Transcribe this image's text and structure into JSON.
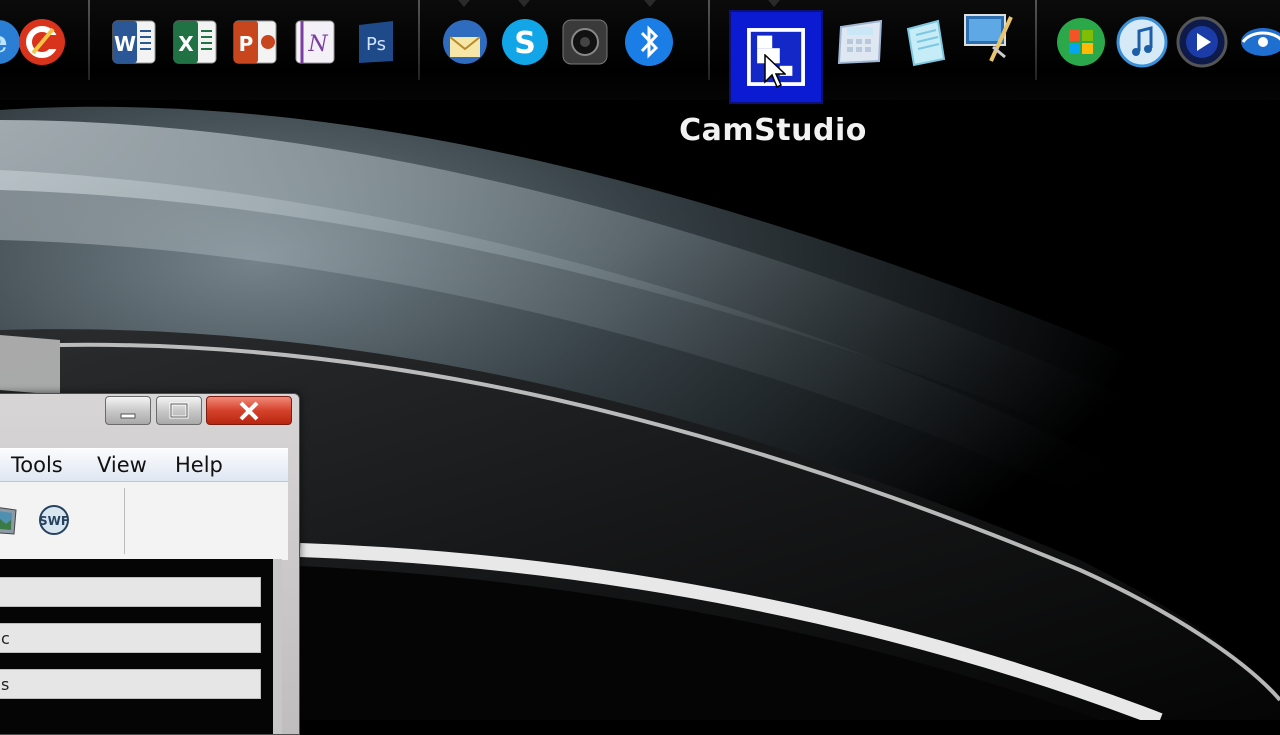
{
  "dock": {
    "label": "CamStudio",
    "icons": [
      {
        "name": "ie-icon",
        "color": "#1f72c4"
      },
      {
        "name": "ccleaner-icon",
        "color": "#d9331c"
      },
      {
        "name": "word-icon",
        "color": "#2b5797",
        "glyph": "W"
      },
      {
        "name": "excel-icon",
        "color": "#207245",
        "glyph": "X"
      },
      {
        "name": "powerpoint-icon",
        "color": "#c8461e",
        "glyph": "P"
      },
      {
        "name": "onenote-icon",
        "color": "#7b3fa3",
        "glyph": "N"
      },
      {
        "name": "photoshop-icon",
        "color": "#1e4a8a",
        "glyph": "Ps"
      },
      {
        "name": "thunderbird-icon",
        "color": "#2f6bbf"
      },
      {
        "name": "skype-icon",
        "color": "#12a5e8",
        "glyph": "S"
      },
      {
        "name": "webcam-icon",
        "color": "#2a2a2a"
      },
      {
        "name": "bluetooth-icon",
        "color": "#1b7ee6"
      },
      {
        "name": "camstudio-icon",
        "color": "#1428c8"
      },
      {
        "name": "calculator-icon",
        "color": "#9fb7d4"
      },
      {
        "name": "notepad-icon",
        "color": "#7ec7e0"
      },
      {
        "name": "paint-icon",
        "color": "#2c6fb0"
      },
      {
        "name": "windows-icon",
        "color": "#2aa84a"
      },
      {
        "name": "itunes-icon",
        "color": "#3a8fd6"
      },
      {
        "name": "media-player-icon",
        "color": "#1a3ba8"
      },
      {
        "name": "dvd-icon",
        "color": "#1f6fd1"
      }
    ]
  },
  "window": {
    "controls": {
      "minimize": "–",
      "maximize": "□",
      "close": "X"
    },
    "menu": {
      "tools": "Tools",
      "view": "View",
      "help": "Help"
    },
    "toolbar": {
      "annotation_icon": "picture-icon",
      "swf_icon": "swf-icon",
      "swf_label": "SWF"
    },
    "fields": [
      {
        "text": ""
      },
      {
        "text": "c"
      },
      {
        "text": "s"
      }
    ]
  }
}
